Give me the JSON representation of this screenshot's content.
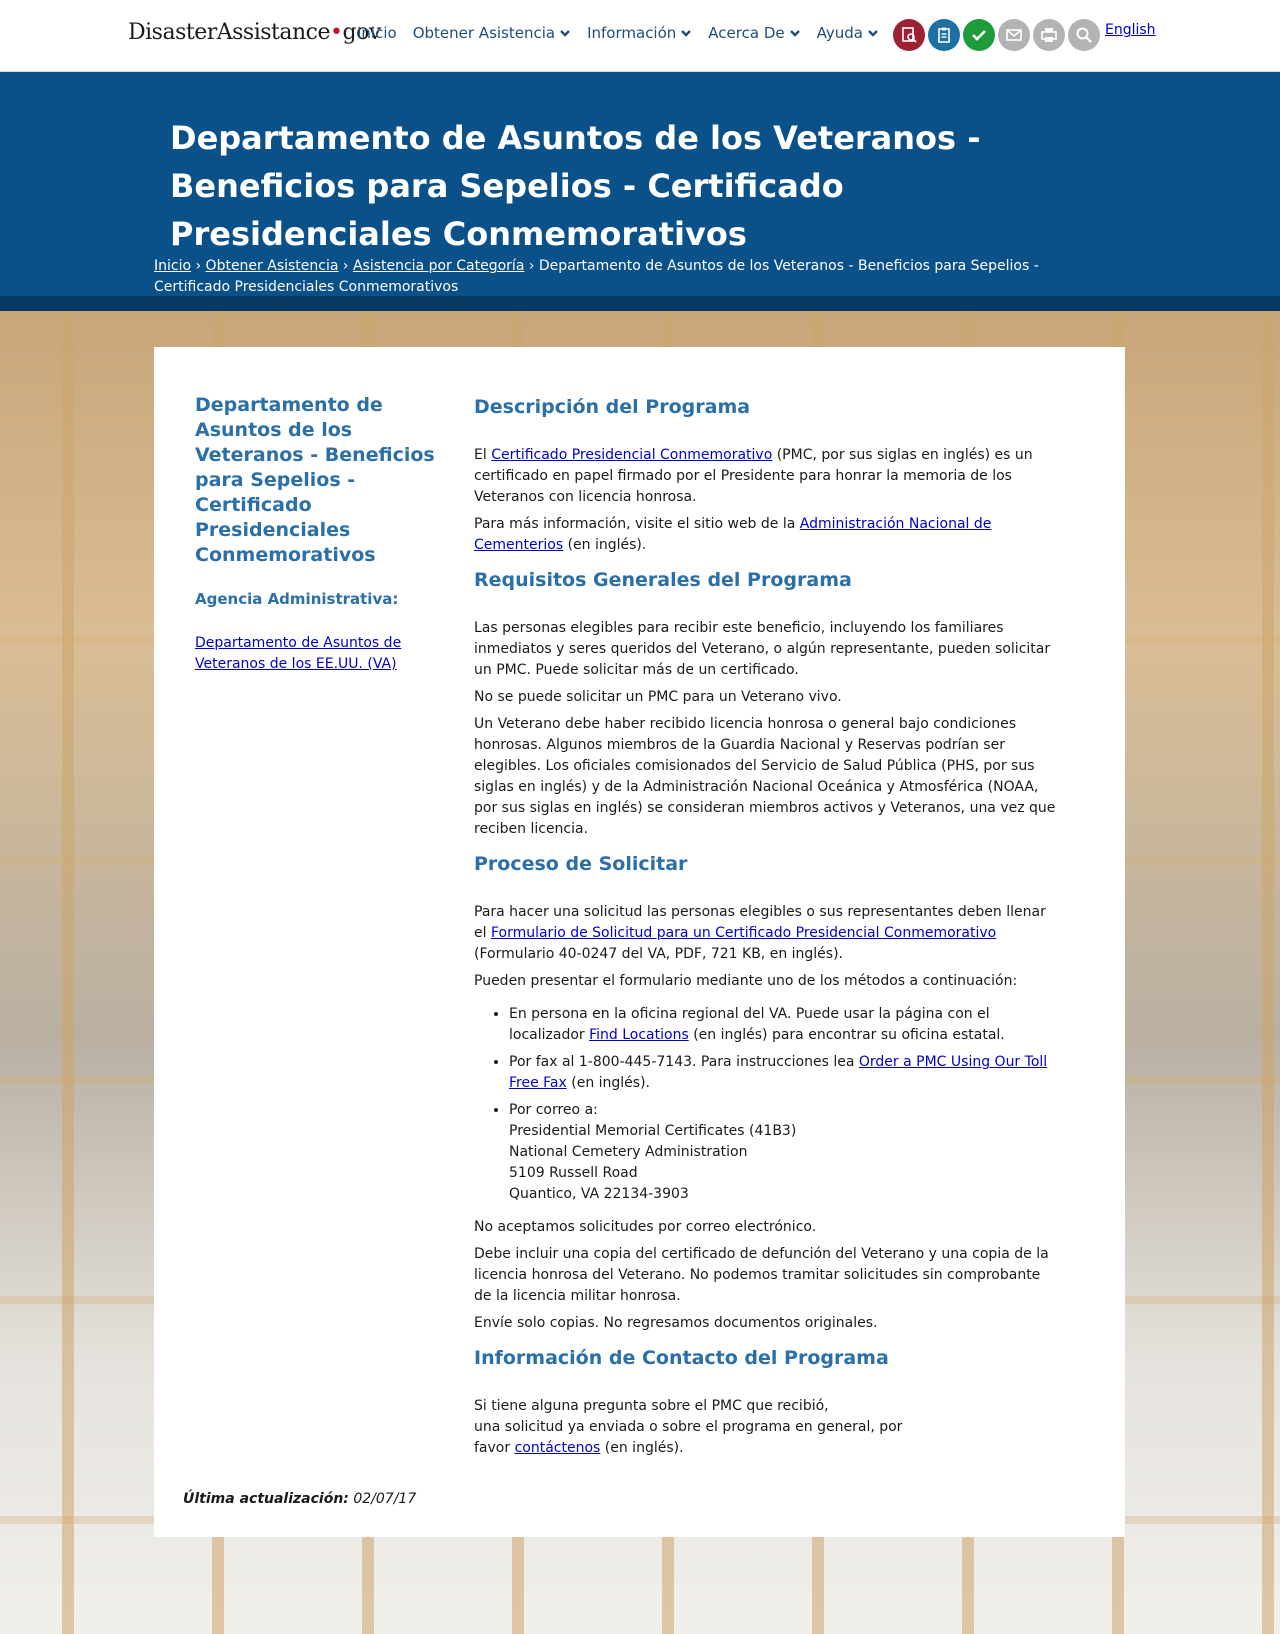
{
  "header": {
    "logo_main": "Disaster",
    "logo_assist": "Assistance",
    "logo_dot": "•",
    "logo_gov": "gov",
    "nav": [
      "Inicio",
      "Obtener Asistencia",
      "Información",
      "Acerca De",
      "Ayuda"
    ],
    "language_link": "English",
    "tools": [
      {
        "name": "search-document-icon",
        "color": "#9c2132"
      },
      {
        "name": "clipboard-icon",
        "color": "#1e6fa3"
      },
      {
        "name": "checkmark-icon",
        "color": "#1e9b3a"
      },
      {
        "name": "email-icon",
        "color": "#b3b3b3"
      },
      {
        "name": "print-icon",
        "color": "#b3b3b3"
      },
      {
        "name": "magnifier-icon",
        "color": "#b3b3b3"
      }
    ]
  },
  "hero": {
    "title": "Departamento de Asuntos de los Veteranos - Beneficios para Sepelios - Certificado Presidenciales Conmemorativos",
    "breadcrumb": {
      "home": "Inicio",
      "sep1": " › ",
      "get_assistance": "Obtener Asistencia",
      "sep2": " › ",
      "by_category": "Asistencia por Categoría",
      "sep3": " › ",
      "current": "Departamento de Asuntos de los Veteranos - Beneficios para Sepelios - Certificado Presidenciales Conmemorativos"
    }
  },
  "sidebar": {
    "title": "Departamento de Asuntos de los Veteranos - Beneficios para Sepelios - Certificado Presidenciales Conmemorativos",
    "agency_label": "Agencia Administrativa:",
    "agency_link": "Departamento de Asuntos de Veteranos de los EE.UU. (VA)"
  },
  "sections": {
    "description": {
      "heading": "Descripción del Programa",
      "p1_pre": "El ",
      "p1_link": "Certificado Presidencial Conmemorativo",
      "p1_post": " (PMC, por sus siglas en inglés) es un certificado en papel firmado por el Presidente para honrar la memoria de los Veteranos con licencia honrosa.",
      "p2_pre": "Para más información, visite el sitio web de la ",
      "p2_link": "Administración Nacional de Cementerios",
      "p2_post": " (en inglés)."
    },
    "requirements": {
      "heading": "Requisitos Generales del Programa",
      "p1": "Las personas elegibles para recibir este beneficio, incluyendo los familiares inmediatos y seres queridos del Veterano, o algún representante, pueden solicitar un PMC. Puede solicitar más de un certificado.",
      "p2": "No se puede solicitar un PMC para un Veterano vivo.",
      "p3": "Un Veterano debe haber recibido licencia honrosa o general bajo condiciones honrosas. Algunos miembros de la Guardia Nacional y Reservas podrían ser elegibles. Los oficiales comisionados del Servicio de Salud Pública (PHS, por sus siglas en inglés) y de la Administración Nacional Oceánica y Atmosférica (NOAA, por sus siglas en inglés) se consideran miembros activos y Veteranos, una vez que reciben licencia."
    },
    "process": {
      "heading": "Proceso de Solicitar",
      "p1_pre": "Para hacer una solicitud las personas elegibles o sus representantes deben llenar el ",
      "p1_link": "Formulario de Solicitud para un Certificado Presidencial Conmemorativo",
      "p1_post": " (Formulario 40-0247 del VA, PDF, 721 KB, en inglés).",
      "p2": "Pueden presentar el formulario mediante uno de los métodos a continuación:",
      "li1_pre": "En persona en la oficina regional del VA. Puede usar la página con el localizador ",
      "li1_link": "Find Locations",
      "li1_post": " (en inglés) para encontrar su oficina estatal.",
      "li2_pre": "Por fax al 1-800-445-7143. Para instrucciones lea ",
      "li2_link": "Order a PMC Using Our Toll Free Fax",
      "li2_post": " (en inglés).",
      "li3_label": "Por correo a:",
      "li3_addr1": "Presidential Memorial Certificates (41B3)",
      "li3_addr2": "National Cemetery Administration",
      "li3_addr3": "5109 Russell Road",
      "li3_addr4": "Quantico, VA 22134-3903",
      "p3": "No aceptamos solicitudes por correo electrónico.",
      "p4": "Debe incluir una copia del certificado de defunción del Veterano y una copia de la licencia honrosa del Veterano. No podemos tramitar solicitudes sin comprobante de la licencia militar honrosa.",
      "p5": "Envíe solo copias. No regresamos documentos originales."
    },
    "contact": {
      "heading": "Información de Contacto del Programa",
      "line1": "Si tiene alguna pregunta sobre el PMC que recibió,",
      "line2": "una solicitud ya enviada o sobre el programa en general, por",
      "line3_pre": "favor ",
      "line3_link": "contáctenos",
      "line3_post": " (en inglés)."
    }
  },
  "footer": {
    "updated_label": "Última actualización:",
    "updated_date": " 02/07/17"
  }
}
